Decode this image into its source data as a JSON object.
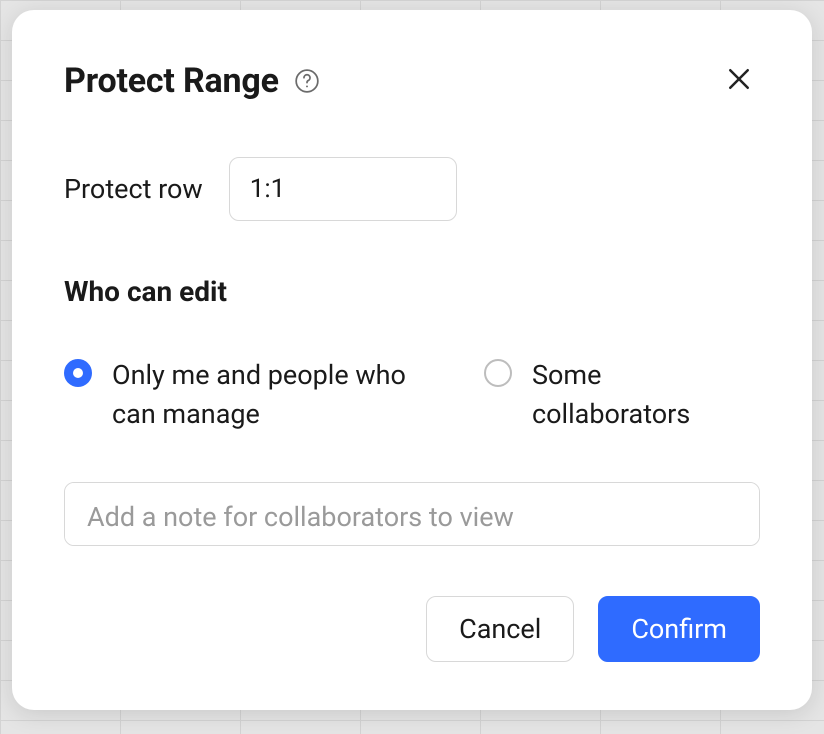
{
  "dialog": {
    "title": "Protect Range",
    "row_field": {
      "label": "Protect row",
      "value": "1:1"
    },
    "who_can_edit_heading": "Who can edit",
    "radio_options": {
      "only_me": {
        "label": "Only me and people who can manage",
        "selected": true
      },
      "some_collab": {
        "label": "Some collaborators",
        "selected": false
      }
    },
    "note_placeholder": "Add a note for collaborators to view",
    "note_value": "",
    "buttons": {
      "cancel": "Cancel",
      "confirm": "Confirm"
    }
  },
  "colors": {
    "accent": "#2f6bff",
    "border": "#d8d8d8",
    "text": "#1a1a1a",
    "placeholder": "#9a9a9a"
  }
}
